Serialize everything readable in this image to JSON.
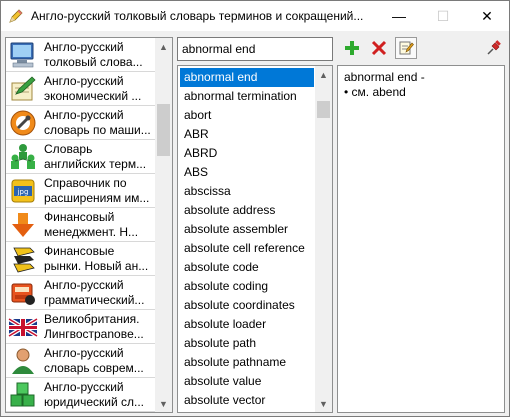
{
  "window": {
    "title": "Англо-русский толковый словарь терминов и сокращений...",
    "minimize_glyph": "—",
    "maximize_glyph": "☐",
    "close_glyph": "✕"
  },
  "dictionaries": [
    {
      "label": "Англо-русский\nтолковый слова...",
      "icon": "computer-icon"
    },
    {
      "label": "Англо-русский\nэкономический ...",
      "icon": "notepad-pencil-icon"
    },
    {
      "label": "Англо-русский\nсловарь по маши...",
      "icon": "mechanical-gear-icon"
    },
    {
      "label": "Словарь\nанглийских терм...",
      "icon": "people-tree-icon"
    },
    {
      "label": "Справочник по\nрасширениям им...",
      "icon": "jpg-file-icon"
    },
    {
      "label": "Финансовый\nменеджмент. Н...",
      "icon": "down-arrow-icon"
    },
    {
      "label": "Финансовые\nрынки. Новый ан...",
      "icon": "bull-icon"
    },
    {
      "label": "Англо-русский\nграмматический...",
      "icon": "books-icon"
    },
    {
      "label": "Великобритания.\nЛингвострanoвe...",
      "icon": "uk-flag-icon"
    },
    {
      "label": "Англо-русский\nсловарь соврем...",
      "icon": "person-icon"
    },
    {
      "label": "Англо-русский\nюридический сл...",
      "icon": "green-blocks-icon"
    }
  ],
  "search": {
    "value": "abnormal end"
  },
  "toolbar": {
    "add_icon": "plus-icon",
    "delete_icon": "delete-x-icon",
    "edit_icon": "edit-note-icon",
    "pin_icon": "pushpin-icon"
  },
  "words": [
    "abnormal end",
    "abnormal termination",
    "abort",
    "ABR",
    "ABRD",
    "ABS",
    "abscissa",
    "absolute address",
    "absolute assembler",
    "absolute cell reference",
    "absolute code",
    "absolute coding",
    "absolute coordinates",
    "absolute loader",
    "absolute path",
    "absolute pathname",
    "absolute value",
    "absolute vector"
  ],
  "selected_word_index": 0,
  "article": {
    "headword": "abnormal end -",
    "body": "• см. abend"
  },
  "colors": {
    "selection": "#0078d7",
    "add_green": "#2eaa2e",
    "delete_red": "#d02020"
  }
}
